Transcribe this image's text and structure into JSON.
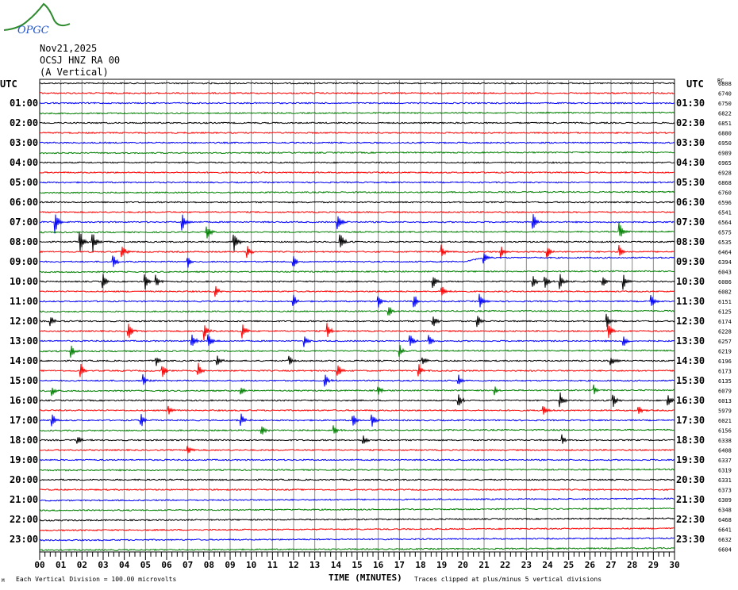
{
  "logo_text": "OPGC",
  "header": {
    "date": "Nov21,2025",
    "station": "OCSJ HNZ RA 00",
    "component": "(A Vertical)"
  },
  "footer": {
    "scale": "Each Vertical Division =  100.00 microvolts",
    "xlabel": "TIME (MINUTES)",
    "clip_note": "Traces clipped at plus/minus 5 vertical divisions",
    "corner_mark": "M"
  },
  "chart_data": {
    "type": "line",
    "title": "OCSJ HNZ RA 00 (A Vertical) Nov21,2025",
    "xlabel": "TIME (MINUTES)",
    "xlim": [
      0,
      30
    ],
    "x_ticks": [
      "00",
      "01",
      "02",
      "03",
      "04",
      "05",
      "06",
      "07",
      "08",
      "09",
      "10",
      "11",
      "12",
      "13",
      "14",
      "15",
      "16",
      "17",
      "18",
      "19",
      "20",
      "21",
      "22",
      "23",
      "24",
      "25",
      "26",
      "27",
      "28",
      "29",
      "30"
    ],
    "grid": true,
    "trace_colors": [
      "#000000",
      "#ff0000",
      "#0000ff",
      "#008000"
    ],
    "left_labels": [
      "UTC",
      "01:00",
      "02:00",
      "03:00",
      "04:00",
      "05:00",
      "06:00",
      "07:00",
      "08:00",
      "09:00",
      "10:00",
      "11:00",
      "12:00",
      "13:00",
      "14:00",
      "15:00",
      "16:00",
      "17:00",
      "18:00",
      "19:00",
      "20:00",
      "21:00",
      "22:00",
      "23:00"
    ],
    "right_labels": [
      "UTC",
      "01:30",
      "02:30",
      "03:30",
      "04:30",
      "05:30",
      "06:30",
      "07:30",
      "08:30",
      "09:30",
      "10:30",
      "11:30",
      "12:30",
      "13:30",
      "14:30",
      "15:30",
      "16:30",
      "17:30",
      "18:30",
      "19:30",
      "20:30",
      "21:30",
      "22:30",
      "23:30"
    ],
    "right_header": "RC",
    "trace_values": [
      "6808",
      "6740",
      "6750",
      "6822",
      "6851",
      "6880",
      "6950",
      "6989",
      "6965",
      "6928",
      "6868",
      "6760",
      "6596",
      "6541",
      "6564",
      "6575",
      "6535",
      "6464",
      "6394",
      "6043",
      "6086",
      "6082",
      "6151",
      "6125",
      "6174",
      "6228",
      "6257",
      "6219",
      "6196",
      "6173",
      "6135",
      "6079",
      "6013",
      "5979",
      "6021",
      "6156",
      "6338",
      "6408",
      "6337",
      "6319",
      "6331",
      "6373",
      "6309",
      "6348",
      "6468",
      "6641",
      "6632",
      "6604"
    ],
    "events": [
      {
        "trace": 14,
        "minutes": [
          0.75,
          6.75,
          14.1,
          23.3
        ],
        "amp": 14
      },
      {
        "trace": 15,
        "minutes": [
          7.9,
          27.4
        ],
        "amp": 12
      },
      {
        "trace": 16,
        "minutes": [
          1.9,
          2.5,
          9.2,
          14.2
        ],
        "amp": 15
      },
      {
        "trace": 17,
        "minutes": [
          3.9,
          9.8,
          19,
          21.8,
          24,
          27.4
        ],
        "amp": 9
      },
      {
        "trace": 18,
        "minutes": [
          3.5,
          7,
          12,
          21
        ],
        "amp": 8
      },
      {
        "trace": 20,
        "minutes": [
          3,
          5,
          5.5,
          18.6,
          23.3,
          23.9,
          24.6,
          26.6,
          27.6
        ],
        "amp": 10
      },
      {
        "trace": 21,
        "minutes": [
          8.3,
          19
        ],
        "amp": 9
      },
      {
        "trace": 22,
        "minutes": [
          12,
          16,
          17.7,
          20.8,
          28.9
        ],
        "amp": 10
      },
      {
        "trace": 23,
        "minutes": [
          16.5
        ],
        "amp": 8
      },
      {
        "trace": 24,
        "minutes": [
          0.5,
          18.6,
          20.7,
          26.8
        ],
        "amp": 9
      },
      {
        "trace": 25,
        "minutes": [
          4.2,
          7.8,
          9.6,
          13.6,
          26.9
        ],
        "amp": 12
      },
      {
        "trace": 26,
        "minutes": [
          7.2,
          8,
          12.5,
          17.5,
          18.4,
          27.6
        ],
        "amp": 9
      },
      {
        "trace": 27,
        "minutes": [
          1.5,
          17
        ],
        "amp": 9
      },
      {
        "trace": 28,
        "minutes": [
          5.5,
          8.4,
          11.8,
          18.1,
          27
        ],
        "amp": 7
      },
      {
        "trace": 29,
        "minutes": [
          1.95,
          5.8,
          7.5,
          14.1,
          17.9
        ],
        "amp": 10
      },
      {
        "trace": 30,
        "minutes": [
          4.9,
          13.5,
          19.8
        ],
        "amp": 8
      },
      {
        "trace": 31,
        "minutes": [
          0.6,
          9.5,
          16,
          21.5,
          26.2
        ],
        "amp": 7
      },
      {
        "trace": 32,
        "minutes": [
          19.8,
          24.6,
          27.1,
          29.7
        ],
        "amp": 10
      },
      {
        "trace": 33,
        "minutes": [
          6.1,
          23.8,
          28.3
        ],
        "amp": 7
      },
      {
        "trace": 34,
        "minutes": [
          0.6,
          4.8,
          9.5,
          14.8,
          15.7
        ],
        "amp": 10
      },
      {
        "trace": 35,
        "minutes": [
          10.5,
          13.9
        ],
        "amp": 7
      },
      {
        "trace": 36,
        "minutes": [
          1.8,
          15.3,
          24.7
        ],
        "amp": 7
      },
      {
        "trace": 37,
        "minutes": [
          7
        ],
        "amp": 7
      }
    ]
  }
}
